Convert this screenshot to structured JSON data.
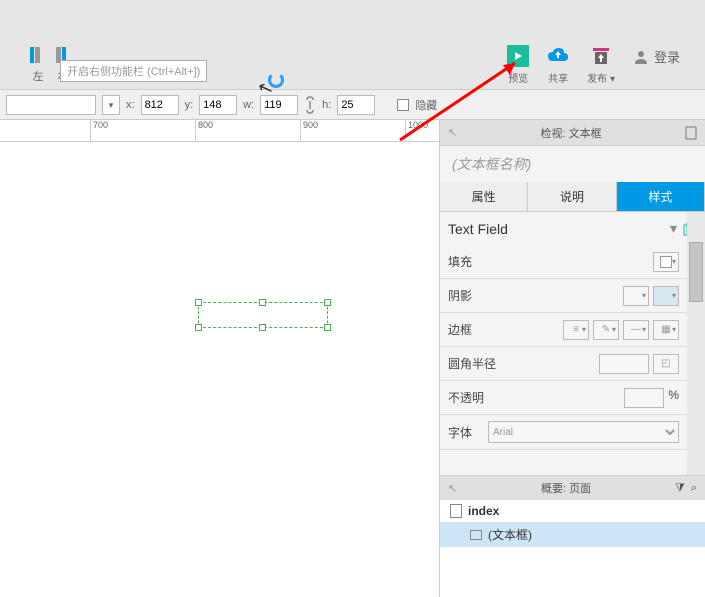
{
  "topbar": {
    "align_left": "左",
    "align_right": "右",
    "tooltip": "开启右侧功能栏 (Ctrl+Alt+])",
    "preview": "预览",
    "share": "共享",
    "publish": "发布",
    "login": "登录"
  },
  "props": {
    "x_label": "x:",
    "x": "812",
    "y_label": "y:",
    "y": "148",
    "w_label": "w:",
    "w": "119",
    "h_label": "h:",
    "h": "25",
    "hide": "隐藏"
  },
  "ruler": [
    "700",
    "800",
    "900",
    "1000"
  ],
  "inspector": {
    "header": "检视: 文本框",
    "name_placeholder": "(文本框名称)",
    "tab_props": "属性",
    "tab_notes": "说明",
    "tab_style": "样式",
    "widget_type": "Text Field",
    "fill": "填充",
    "shadow": "阴影",
    "border": "边框",
    "radius": "圆角半径",
    "opacity": "不透明",
    "opacity_unit": "%",
    "font": "字体",
    "font_value": "Arial"
  },
  "outline": {
    "header": "概要: 页面",
    "page": "index",
    "item": "(文本框)"
  }
}
